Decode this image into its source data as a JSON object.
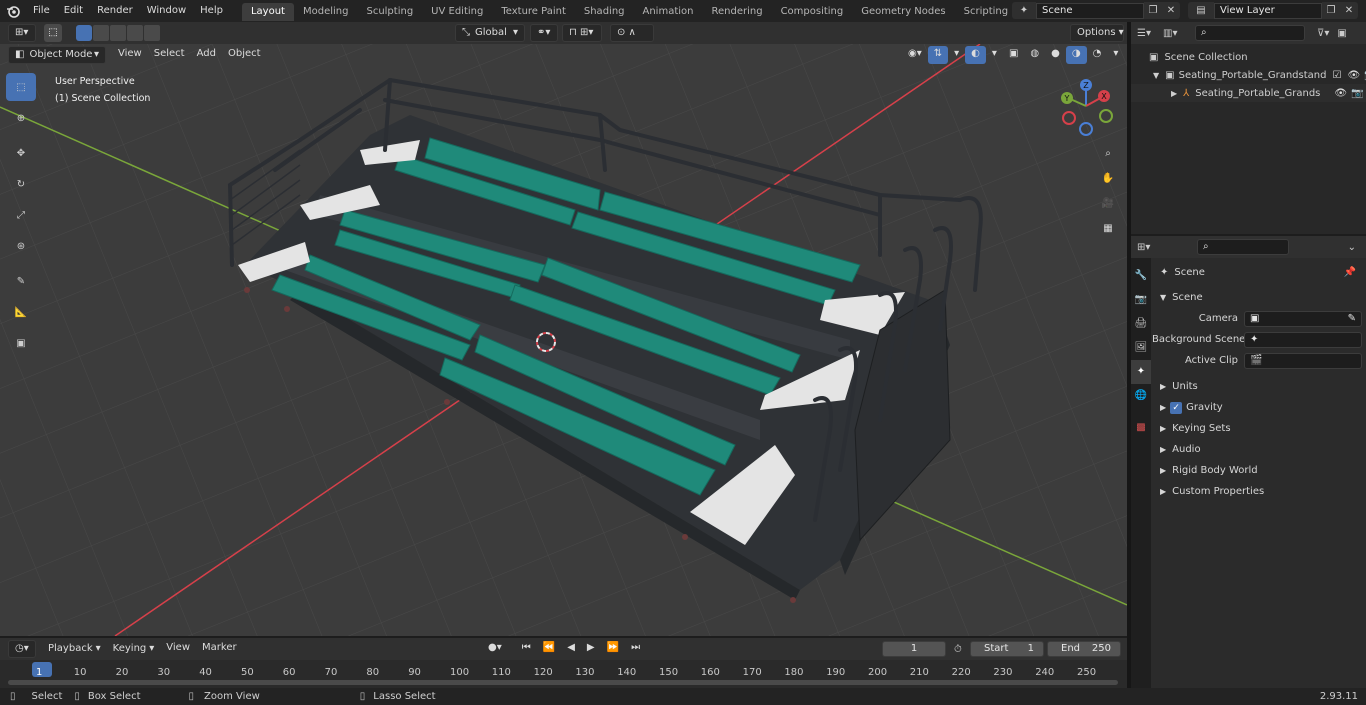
{
  "menubar": {
    "items": [
      "File",
      "Edit",
      "Render",
      "Window",
      "Help"
    ],
    "workspaces": [
      "Layout",
      "Modeling",
      "Sculpting",
      "UV Editing",
      "Texture Paint",
      "Shading",
      "Animation",
      "Rendering",
      "Compositing",
      "Geometry Nodes",
      "Scripting"
    ],
    "active_workspace": "Layout",
    "scene_name": "Scene",
    "view_layer": "View Layer"
  },
  "viewport_header": {
    "transform_orientation": "Global",
    "options_label": "Options",
    "mode": "Object Mode",
    "menus": [
      "View",
      "Select",
      "Add",
      "Object"
    ]
  },
  "viewport_overlay": {
    "perspective": "User Perspective",
    "collection": "(1) Scene Collection",
    "gizmo_axes": [
      "X",
      "Y",
      "Z"
    ]
  },
  "outliner": {
    "root": "Scene Collection",
    "items": [
      {
        "label": "Seating_Portable_Grandstand",
        "indent": 1
      },
      {
        "label": "Seating_Portable_Grands",
        "indent": 2
      }
    ]
  },
  "properties": {
    "context_label": "Scene",
    "panel_title": "Scene",
    "fields": [
      {
        "label": "Camera"
      },
      {
        "label": "Background Scene"
      },
      {
        "label": "Active Clip"
      }
    ],
    "panels": [
      "Units",
      "Gravity",
      "Keying Sets",
      "Audio",
      "Rigid Body World",
      "Custom Properties"
    ],
    "gravity_checked": true
  },
  "timeline": {
    "menus": [
      "Playback",
      "Keying",
      "View",
      "Marker"
    ],
    "current_frame": "1",
    "start_label": "Start",
    "start_value": "1",
    "end_label": "End",
    "end_value": "250",
    "ruler": [
      "1",
      "10",
      "20",
      "30",
      "40",
      "50",
      "60",
      "70",
      "80",
      "90",
      "100",
      "110",
      "120",
      "130",
      "140",
      "150",
      "160",
      "170",
      "180",
      "190",
      "200",
      "210",
      "220",
      "230",
      "240",
      "250"
    ]
  },
  "statusbar": {
    "hints": [
      "Select",
      "Box Select",
      "Zoom View",
      "Lasso Select"
    ],
    "version": "2.93.11"
  },
  "colors": {
    "accent": "#4772b3",
    "seat": "#1f8a7a",
    "x_axis": "#d6404a",
    "y_axis": "#7aa63a",
    "z_axis": "#4a7fd6"
  }
}
